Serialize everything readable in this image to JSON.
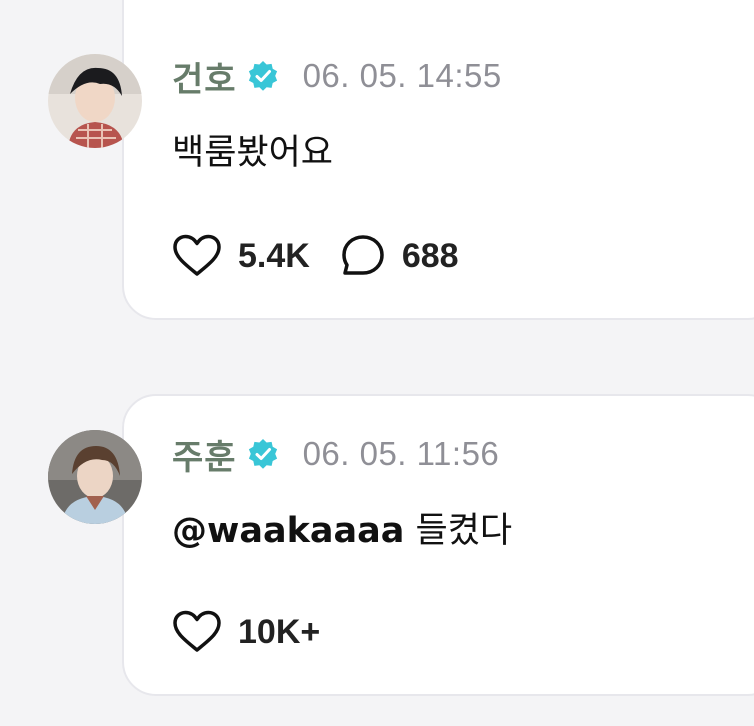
{
  "posts": [
    {
      "author": "건호",
      "verified": true,
      "timestamp": "06. 05. 14:55",
      "text": "백룸봤어요",
      "likes": "5.4K",
      "comments": "688"
    },
    {
      "author": "주훈",
      "verified": true,
      "timestamp": "06. 05. 11:56",
      "mention": "@waakaaaa",
      "text": " 들켰다",
      "likes": "10K+"
    }
  ],
  "colors": {
    "name": "#677c6a",
    "badge": "#39c6d7",
    "timestamp": "#8f8f96",
    "card_border": "#e7e7ec",
    "background": "#f4f4f6"
  },
  "icons": {
    "verified": "verified-badge-icon",
    "like": "heart-icon",
    "comment": "speech-bubble-icon"
  }
}
